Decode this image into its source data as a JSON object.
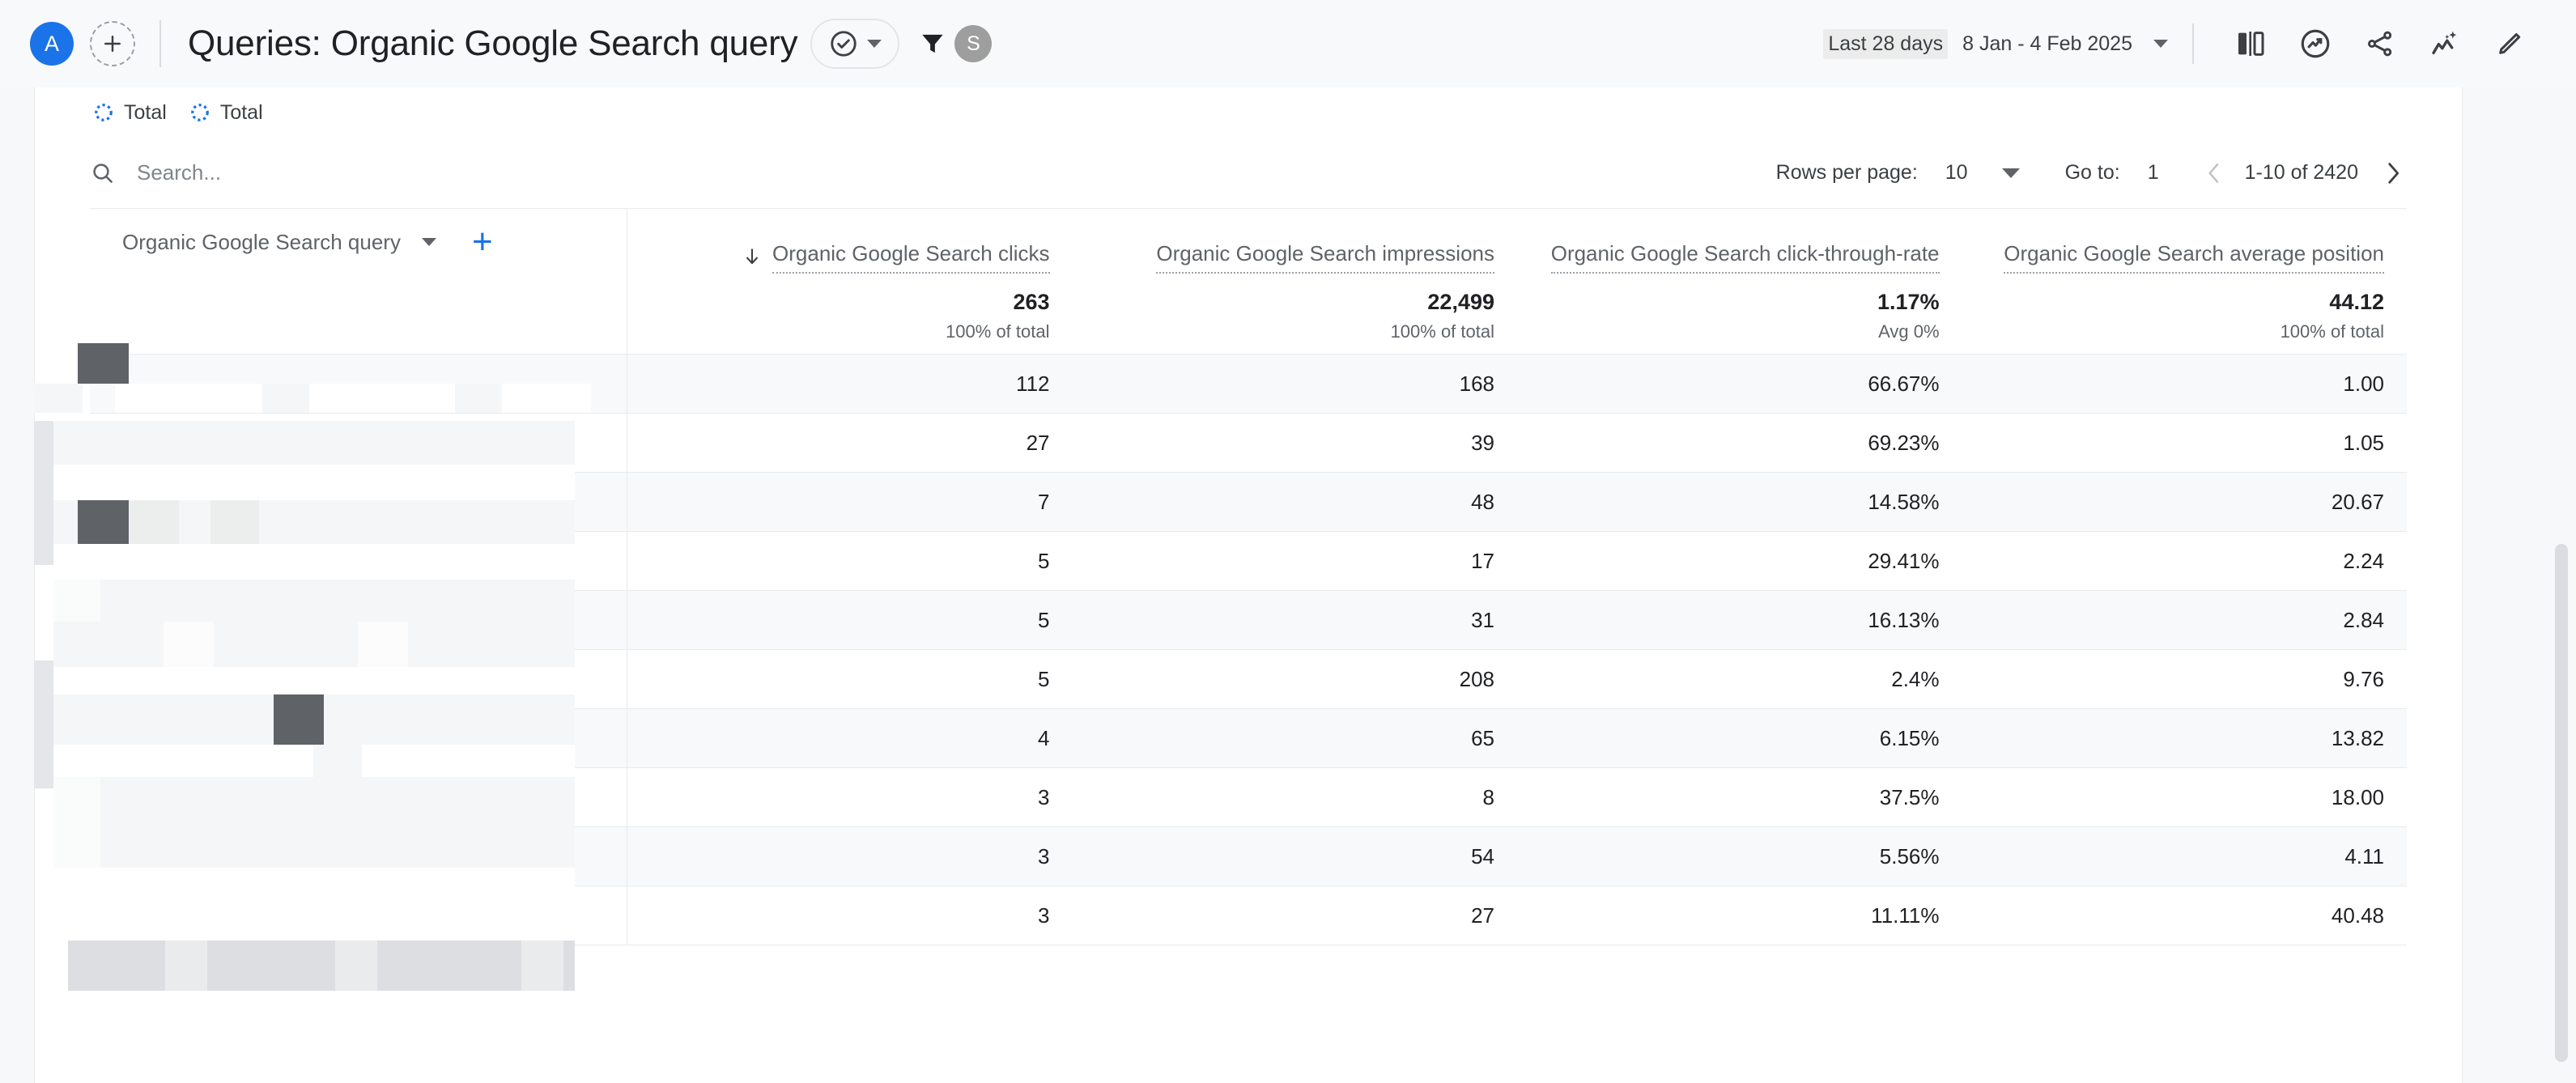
{
  "topbar": {
    "account_initial": "A",
    "add_account_icon": "plus-circle-dashed-icon",
    "title": "Queries: Organic Google Search query",
    "valid_chip": {
      "icon": "check-circle-icon",
      "caret": "chevron-down-icon"
    },
    "filter_icon": "filter-funnel-icon",
    "segment_initial": "S",
    "date_range": {
      "label": "Last 28 days",
      "value": "8 Jan - 4 Feb 2025",
      "caret": "chevron-down-icon"
    },
    "tools": [
      {
        "name": "compare-panels-icon",
        "label": "Compare"
      },
      {
        "name": "insights-chart-circle-icon",
        "label": "Insights"
      },
      {
        "name": "share-icon",
        "label": "Share"
      },
      {
        "name": "ai-sparkle-chart-icon",
        "label": "Explore"
      },
      {
        "name": "edit-pencil-icon",
        "label": "Edit"
      }
    ]
  },
  "chips": [
    {
      "icon": "loading-spinner-icon",
      "label": "Total"
    },
    {
      "icon": "loading-spinner-icon",
      "label": "Total"
    }
  ],
  "search": {
    "icon": "search-icon",
    "placeholder": "Search...",
    "value": ""
  },
  "pagination": {
    "rows_per_page_label": "Rows per page:",
    "rows_per_page_value": "10",
    "goto_label": "Go to:",
    "goto_value": "1",
    "range_text": "1-10 of 2420",
    "prev_icon": "chevron-left-icon",
    "next_icon": "chevron-right-icon"
  },
  "table": {
    "dimension_header": {
      "label": "Organic Google Search query",
      "caret": "chevron-down-icon",
      "add_icon": "plus-icon"
    },
    "metric_headers": [
      {
        "label": "Organic Google Search clicks",
        "sorted": true,
        "sort_icon": "arrow-down-icon"
      },
      {
        "label": "Organic Google Search impressions",
        "sorted": false,
        "sort_icon": ""
      },
      {
        "label": "Organic Google Search click-through-rate",
        "sorted": false,
        "sort_icon": ""
      },
      {
        "label": "Organic Google Search average position",
        "sorted": false,
        "sort_icon": ""
      }
    ],
    "summary": [
      {
        "value": "263",
        "sub": "100% of total"
      },
      {
        "value": "22,499",
        "sub": "100% of total"
      },
      {
        "value": "1.17%",
        "sub": "Avg 0%"
      },
      {
        "value": "44.12",
        "sub": "100% of total"
      }
    ],
    "rows": [
      {
        "dimension": "",
        "clicks": "112",
        "impressions": "168",
        "ctr": "66.67%",
        "position": "1.00"
      },
      {
        "dimension": "",
        "clicks": "27",
        "impressions": "39",
        "ctr": "69.23%",
        "position": "1.05"
      },
      {
        "dimension": "",
        "clicks": "7",
        "impressions": "48",
        "ctr": "14.58%",
        "position": "20.67"
      },
      {
        "dimension": "",
        "clicks": "5",
        "impressions": "17",
        "ctr": "29.41%",
        "position": "2.24"
      },
      {
        "dimension": "",
        "clicks": "5",
        "impressions": "31",
        "ctr": "16.13%",
        "position": "2.84"
      },
      {
        "dimension": "",
        "clicks": "5",
        "impressions": "208",
        "ctr": "2.4%",
        "position": "9.76"
      },
      {
        "dimension": "",
        "clicks": "4",
        "impressions": "65",
        "ctr": "6.15%",
        "position": "13.82"
      },
      {
        "dimension": "",
        "clicks": "3",
        "impressions": "8",
        "ctr": "37.5%",
        "position": "18.00"
      },
      {
        "dimension": "",
        "clicks": "3",
        "impressions": "54",
        "ctr": "5.56%",
        "position": "4.11"
      },
      {
        "dimension": "",
        "clicks": "3",
        "impressions": "27",
        "ctr": "11.11%",
        "position": "40.48"
      }
    ]
  },
  "colors": {
    "accent_blue": "#1a73e8",
    "text_primary": "#202124",
    "text_secondary": "#5f6368",
    "row_alt": "#f8f9fa",
    "border": "#e8eaed"
  }
}
